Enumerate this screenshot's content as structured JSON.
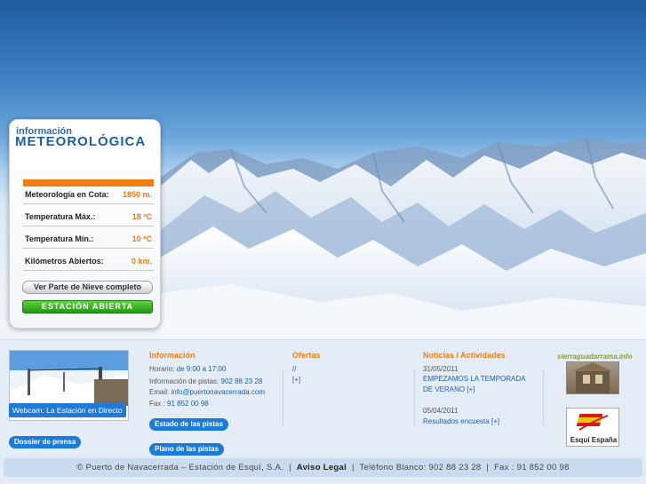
{
  "weather": {
    "title_small": "información",
    "title_big": "METEOROLÓGICA",
    "rows": [
      {
        "label": "Meteorología en Cota:",
        "value": "1850 m."
      },
      {
        "label": "Temperatura Máx.:",
        "value": "18 ºC"
      },
      {
        "label": "Temperatura Mín.:",
        "value": "10 ºC"
      },
      {
        "label": "Kilómetros Abiertos:",
        "value": "0 km."
      }
    ],
    "report_button": "Ver Parte de Nieve completo",
    "status_button": "ESTACIÓN ABIERTA"
  },
  "webcam": {
    "label": "Webcam: La Estación en Directo",
    "press_button": "Dossier de prensa"
  },
  "info": {
    "title": "Información",
    "hours_label": "Horario:",
    "hours_value": "de 9:00 a 17:00",
    "slopes_label": "Información de pistas:",
    "slopes_phone": "902 88 23 28",
    "email_label": "Email:",
    "email_value": "info@puertonavacerrada.com",
    "fax_label": "Fax :",
    "fax_value": "91 852 00 98",
    "status_button": "Estado de las pistas",
    "map_button": "Plano de las pistas"
  },
  "offers": {
    "title": "Ofertas",
    "line1": "//",
    "more": "[+]"
  },
  "news": {
    "title": "Noticias / Actividades",
    "items": [
      {
        "date": "31/05/2011",
        "text": "EMPEZAMOS LA TEMPORADA",
        "text2": "DE VERANO [+]"
      },
      {
        "date": "05/04/2011",
        "text": "Resultados encuesta [+]"
      }
    ]
  },
  "partners": {
    "sierra": "sierraguadarrama.info",
    "esqui": "Esquí España"
  },
  "footer": {
    "left": "© Puerto de Navacerrada – Estación de Esquí, S.A.",
    "legal": "Aviso Legal",
    "phone": "Teléfono Blanco: 902 88 23 28",
    "fax": "Fax : 91 852 00 98",
    "sep": "|"
  },
  "colors": {
    "accent": "#f07d14",
    "brand_blue": "#1c7bd8",
    "green": "#2aa91a"
  }
}
